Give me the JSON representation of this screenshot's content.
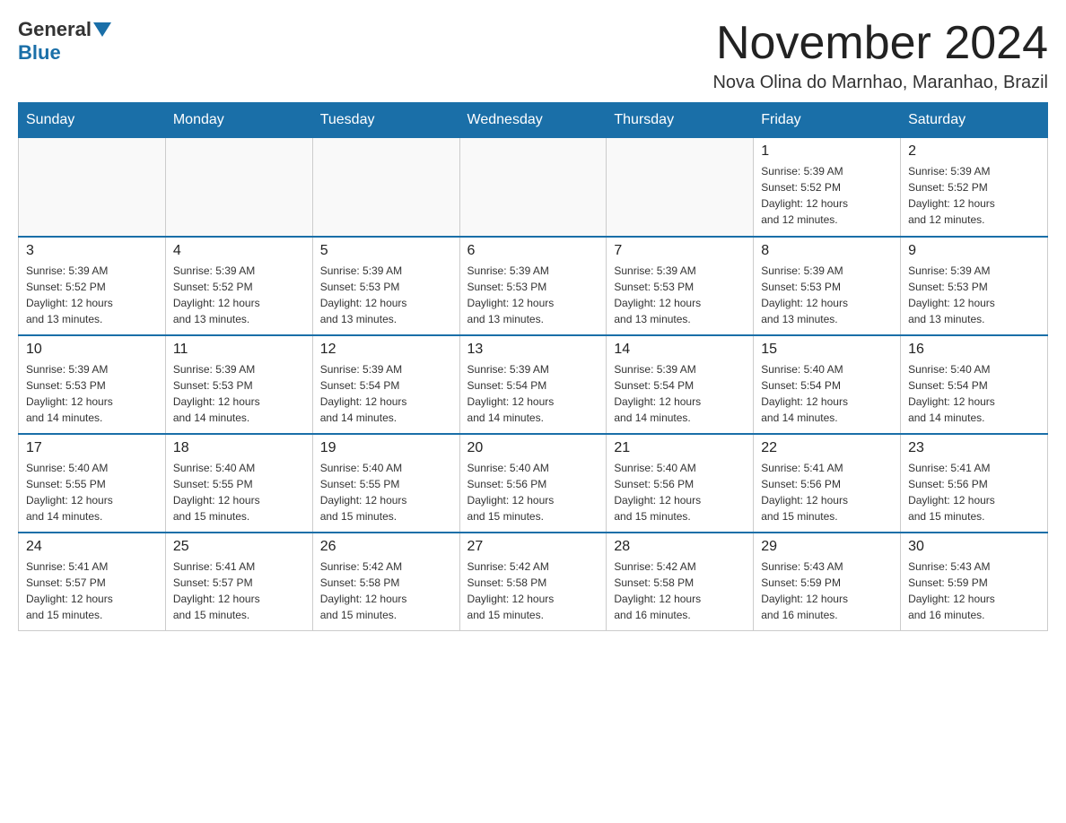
{
  "header": {
    "logo_general": "General",
    "logo_blue": "Blue",
    "month_title": "November 2024",
    "location": "Nova Olina do Marnhao, Maranhao, Brazil"
  },
  "days_of_week": [
    "Sunday",
    "Monday",
    "Tuesday",
    "Wednesday",
    "Thursday",
    "Friday",
    "Saturday"
  ],
  "weeks": [
    [
      {
        "day": "",
        "info": ""
      },
      {
        "day": "",
        "info": ""
      },
      {
        "day": "",
        "info": ""
      },
      {
        "day": "",
        "info": ""
      },
      {
        "day": "",
        "info": ""
      },
      {
        "day": "1",
        "info": "Sunrise: 5:39 AM\nSunset: 5:52 PM\nDaylight: 12 hours\nand 12 minutes."
      },
      {
        "day": "2",
        "info": "Sunrise: 5:39 AM\nSunset: 5:52 PM\nDaylight: 12 hours\nand 12 minutes."
      }
    ],
    [
      {
        "day": "3",
        "info": "Sunrise: 5:39 AM\nSunset: 5:52 PM\nDaylight: 12 hours\nand 13 minutes."
      },
      {
        "day": "4",
        "info": "Sunrise: 5:39 AM\nSunset: 5:52 PM\nDaylight: 12 hours\nand 13 minutes."
      },
      {
        "day": "5",
        "info": "Sunrise: 5:39 AM\nSunset: 5:53 PM\nDaylight: 12 hours\nand 13 minutes."
      },
      {
        "day": "6",
        "info": "Sunrise: 5:39 AM\nSunset: 5:53 PM\nDaylight: 12 hours\nand 13 minutes."
      },
      {
        "day": "7",
        "info": "Sunrise: 5:39 AM\nSunset: 5:53 PM\nDaylight: 12 hours\nand 13 minutes."
      },
      {
        "day": "8",
        "info": "Sunrise: 5:39 AM\nSunset: 5:53 PM\nDaylight: 12 hours\nand 13 minutes."
      },
      {
        "day": "9",
        "info": "Sunrise: 5:39 AM\nSunset: 5:53 PM\nDaylight: 12 hours\nand 13 minutes."
      }
    ],
    [
      {
        "day": "10",
        "info": "Sunrise: 5:39 AM\nSunset: 5:53 PM\nDaylight: 12 hours\nand 14 minutes."
      },
      {
        "day": "11",
        "info": "Sunrise: 5:39 AM\nSunset: 5:53 PM\nDaylight: 12 hours\nand 14 minutes."
      },
      {
        "day": "12",
        "info": "Sunrise: 5:39 AM\nSunset: 5:54 PM\nDaylight: 12 hours\nand 14 minutes."
      },
      {
        "day": "13",
        "info": "Sunrise: 5:39 AM\nSunset: 5:54 PM\nDaylight: 12 hours\nand 14 minutes."
      },
      {
        "day": "14",
        "info": "Sunrise: 5:39 AM\nSunset: 5:54 PM\nDaylight: 12 hours\nand 14 minutes."
      },
      {
        "day": "15",
        "info": "Sunrise: 5:40 AM\nSunset: 5:54 PM\nDaylight: 12 hours\nand 14 minutes."
      },
      {
        "day": "16",
        "info": "Sunrise: 5:40 AM\nSunset: 5:54 PM\nDaylight: 12 hours\nand 14 minutes."
      }
    ],
    [
      {
        "day": "17",
        "info": "Sunrise: 5:40 AM\nSunset: 5:55 PM\nDaylight: 12 hours\nand 14 minutes."
      },
      {
        "day": "18",
        "info": "Sunrise: 5:40 AM\nSunset: 5:55 PM\nDaylight: 12 hours\nand 15 minutes."
      },
      {
        "day": "19",
        "info": "Sunrise: 5:40 AM\nSunset: 5:55 PM\nDaylight: 12 hours\nand 15 minutes."
      },
      {
        "day": "20",
        "info": "Sunrise: 5:40 AM\nSunset: 5:56 PM\nDaylight: 12 hours\nand 15 minutes."
      },
      {
        "day": "21",
        "info": "Sunrise: 5:40 AM\nSunset: 5:56 PM\nDaylight: 12 hours\nand 15 minutes."
      },
      {
        "day": "22",
        "info": "Sunrise: 5:41 AM\nSunset: 5:56 PM\nDaylight: 12 hours\nand 15 minutes."
      },
      {
        "day": "23",
        "info": "Sunrise: 5:41 AM\nSunset: 5:56 PM\nDaylight: 12 hours\nand 15 minutes."
      }
    ],
    [
      {
        "day": "24",
        "info": "Sunrise: 5:41 AM\nSunset: 5:57 PM\nDaylight: 12 hours\nand 15 minutes."
      },
      {
        "day": "25",
        "info": "Sunrise: 5:41 AM\nSunset: 5:57 PM\nDaylight: 12 hours\nand 15 minutes."
      },
      {
        "day": "26",
        "info": "Sunrise: 5:42 AM\nSunset: 5:58 PM\nDaylight: 12 hours\nand 15 minutes."
      },
      {
        "day": "27",
        "info": "Sunrise: 5:42 AM\nSunset: 5:58 PM\nDaylight: 12 hours\nand 15 minutes."
      },
      {
        "day": "28",
        "info": "Sunrise: 5:42 AM\nSunset: 5:58 PM\nDaylight: 12 hours\nand 16 minutes."
      },
      {
        "day": "29",
        "info": "Sunrise: 5:43 AM\nSunset: 5:59 PM\nDaylight: 12 hours\nand 16 minutes."
      },
      {
        "day": "30",
        "info": "Sunrise: 5:43 AM\nSunset: 5:59 PM\nDaylight: 12 hours\nand 16 minutes."
      }
    ]
  ]
}
